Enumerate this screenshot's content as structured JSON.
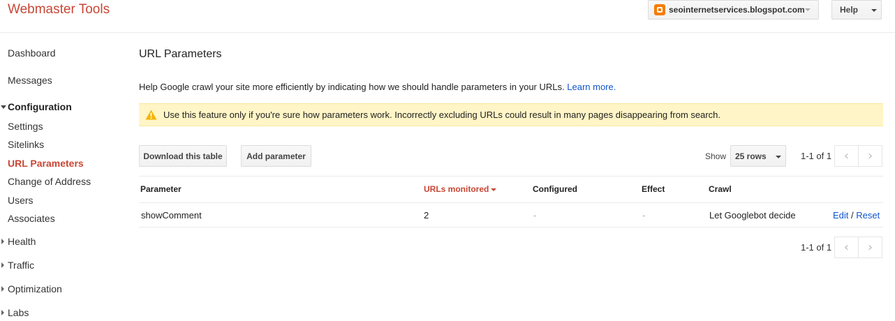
{
  "app": {
    "title": "Webmaster Tools"
  },
  "header": {
    "site_name": "seointernetservices.blogspot.com",
    "help_label": "Help"
  },
  "sidebar": {
    "dashboard": "Dashboard",
    "messages": "Messages",
    "configuration": "Configuration",
    "settings": "Settings",
    "sitelinks": "Sitelinks",
    "url_parameters": "URL Parameters",
    "change_of_address": "Change of Address",
    "users": "Users",
    "associates": "Associates",
    "health": "Health",
    "traffic": "Traffic",
    "optimization": "Optimization",
    "labs": "Labs"
  },
  "main": {
    "title": "URL Parameters",
    "intro": "Help Google crawl your site more efficiently by indicating how we should handle parameters in your URLs.",
    "learn_more": "Learn more.",
    "warning": "Use this feature only if you're sure how parameters work. Incorrectly excluding URLs could result in many pages disappearing from search."
  },
  "toolbar": {
    "download_label": "Download this table",
    "add_label": "Add parameter",
    "show_label": "Show",
    "rows_value": "25 rows",
    "pager_text": "1-1 of 1"
  },
  "table": {
    "headers": {
      "parameter": "Parameter",
      "urls_monitored": "URLs monitored",
      "configured": "Configured",
      "effect": "Effect",
      "crawl": "Crawl"
    },
    "rows": [
      {
        "parameter": "showComment",
        "urls_monitored": "2",
        "configured": "-",
        "effect": "-",
        "crawl": "Let Googlebot decide",
        "edit": "Edit",
        "separator": "/",
        "reset": "Reset"
      }
    ]
  },
  "bottom_pager": {
    "text": "1-1 of 1"
  },
  "icons": {
    "blogger": "blogger-icon",
    "warning": "warning-triangle-icon",
    "prev": "chevron-left-icon",
    "next": "chevron-right-icon"
  },
  "colors": {
    "brand": "#c74634",
    "link": "#1155cc",
    "warning_bg": "#fff5c6",
    "warning_icon": "#f4b400"
  }
}
